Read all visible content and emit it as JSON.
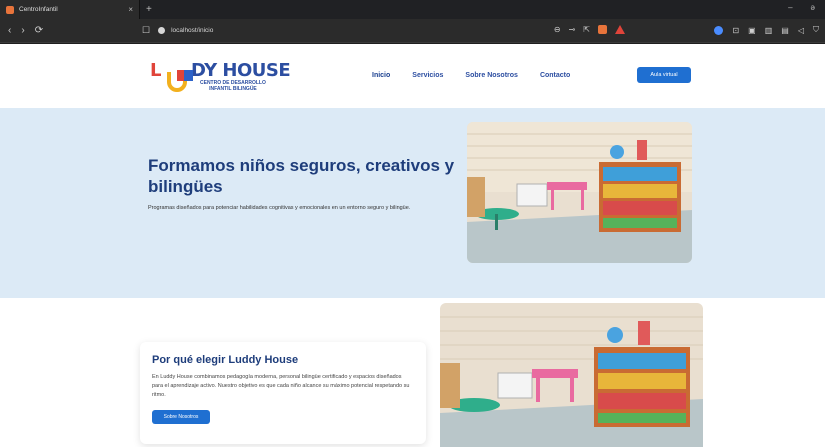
{
  "browser": {
    "tab_title": "CentroInfantil",
    "tab_close": "×",
    "new_tab": "+",
    "url": "localhost/inicio",
    "nav": {
      "back": "‹",
      "forward": "›",
      "reload": "⟳"
    },
    "window_controls": {
      "minimize": "–",
      "restore": "ə"
    }
  },
  "site": {
    "logo": {
      "brand": "LUDDY HOUSE",
      "tagline_line1": "CENTRO DE DESARROLLO",
      "tagline_line2": "INFANTIL BILINGÜE"
    },
    "menu": [
      "Inicio",
      "Servicios",
      "Sobre Nosotros",
      "Contacto"
    ],
    "cta": "Aula virtual",
    "hero": {
      "title": "Formamos niños seguros, creativos y bilingües",
      "subtitle": "Programas diseñados para potenciar habilidades cognitivas y emocionales en un entorno seguro y bilingüe."
    },
    "why": {
      "title": "Por qué elegir Luddy House",
      "text": "En Luddy House combinamos pedagogía moderna, personal bilingüe certificado y espacios diseñados para el aprendizaje activo. Nuestro objetivo es que cada niño alcance su máximo potencial respetando su ritmo.",
      "button": "Sobre Nosotros"
    }
  },
  "colors": {
    "accent": "#1f6fd1",
    "hero_bg": "#dceaf6",
    "brand_red": "#e0443a",
    "brand_blue": "#2c4ea1"
  }
}
